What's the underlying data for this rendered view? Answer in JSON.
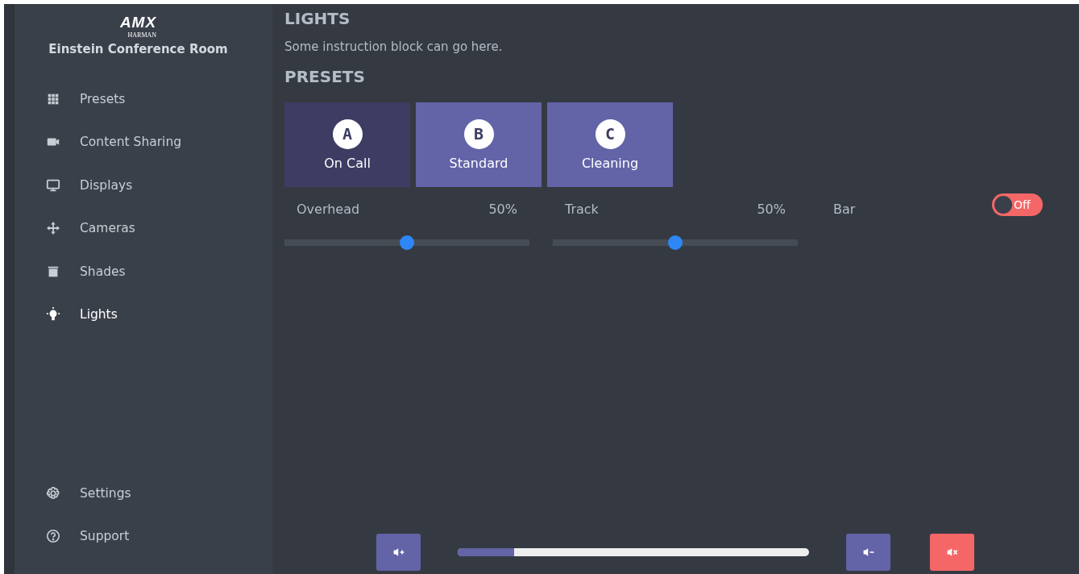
{
  "sidebar": {
    "logo": {
      "brand": "AMX",
      "sub": "HARMAN"
    },
    "room": "Einstein Conference Room",
    "items": [
      {
        "label": "Presets",
        "kind": "grid",
        "selected": false
      },
      {
        "label": "Content Sharing",
        "kind": "share",
        "selected": false
      },
      {
        "label": "Displays",
        "kind": "display",
        "selected": false
      },
      {
        "label": "Cameras",
        "kind": "move",
        "selected": false
      },
      {
        "label": "Shades",
        "kind": "shades",
        "selected": false
      },
      {
        "label": "Lights",
        "kind": "bulb",
        "selected": true
      }
    ],
    "footer_items": [
      {
        "label": "Settings",
        "kind": "gear"
      },
      {
        "label": "Support",
        "kind": "help"
      }
    ]
  },
  "main": {
    "title": "LIGHTS",
    "instruction": "Some instruction block can go here.",
    "presets_title": "PRESETS",
    "presets": [
      {
        "letter": "A",
        "label": "On Call",
        "selected": true
      },
      {
        "letter": "B",
        "label": "Standard",
        "selected": false
      },
      {
        "letter": "C",
        "label": "Cleaning",
        "selected": false
      }
    ],
    "controls": [
      {
        "kind": "slider",
        "label": "Overhead",
        "reading": "50%",
        "level": 0.5
      },
      {
        "kind": "slider",
        "label": "Track",
        "reading": "50%",
        "level": 0.5
      },
      {
        "kind": "toggle",
        "label": "Bar",
        "on": false,
        "state_text": "Off"
      }
    ]
  },
  "volume": {
    "level": 0.16,
    "buttons": [
      {
        "kind": "up"
      },
      {
        "kind": "down"
      },
      {
        "kind": "mute"
      }
    ]
  }
}
